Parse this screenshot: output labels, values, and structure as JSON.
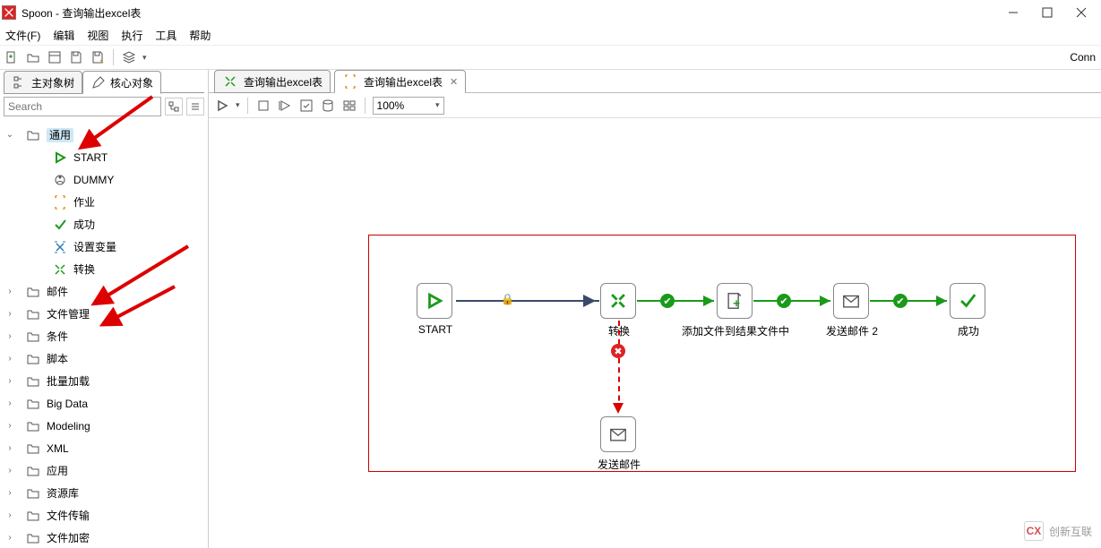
{
  "window": {
    "title": "Spoon - 查询输出excel表",
    "min": "—",
    "max": "□",
    "close": "×"
  },
  "menu": {
    "file": "文件(F)",
    "edit": "编辑",
    "view": "视图",
    "run": "执行",
    "tools": "工具",
    "help": "帮助"
  },
  "toolbar": {
    "connect": "Conn"
  },
  "left_tabs": {
    "tree": "主对象树",
    "core": "核心对象"
  },
  "search": {
    "placeholder": "Search"
  },
  "tree": {
    "root": "通用",
    "children": [
      "START",
      "DUMMY",
      "作业",
      "成功",
      "设置变量",
      "转换"
    ],
    "folders": [
      "邮件",
      "文件管理",
      "条件",
      "脚本",
      "批量加载",
      "Big Data",
      "Modeling",
      "XML",
      "应用",
      "资源库",
      "文件传输",
      "文件加密"
    ]
  },
  "editor_tabs": {
    "tab1": "查询输出excel表",
    "tab2": "查询输出excel表"
  },
  "editor_toolbar": {
    "zoom": "100%"
  },
  "job": {
    "nodes": {
      "start": "START",
      "trans": "转换",
      "addfile": "添加文件到结果文件中",
      "mail2": "发送邮件 2",
      "success": "成功",
      "mail": "发送邮件"
    }
  },
  "watermark": {
    "text": "创新互联"
  }
}
